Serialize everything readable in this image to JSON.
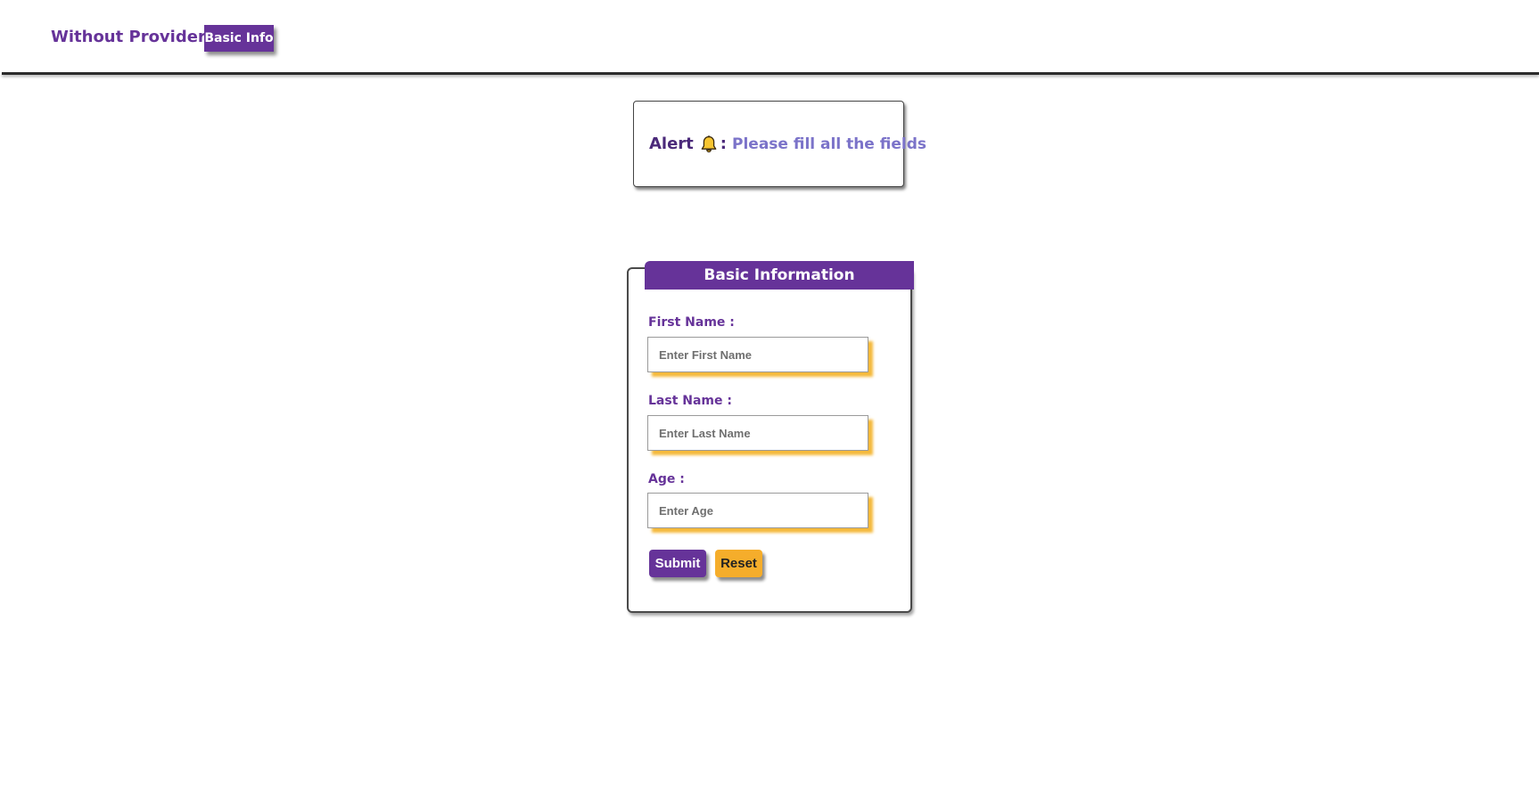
{
  "header": {
    "brand": "Without Providers",
    "nav_button_label": "Basic Info"
  },
  "alert": {
    "label": "Alert",
    "icon": "bell-icon",
    "separator": ":",
    "message": "Please fill all the fields"
  },
  "form": {
    "title": "Basic Information",
    "first_name": {
      "label": "First Name :",
      "placeholder": "Enter First Name",
      "value": ""
    },
    "last_name": {
      "label": "Last Name :",
      "placeholder": "Enter Last Name",
      "value": ""
    },
    "age": {
      "label": "Age :",
      "placeholder": "Enter Age",
      "value": ""
    },
    "submit_label": "Submit",
    "reset_label": "Reset"
  },
  "colors": {
    "primary": "#663399",
    "accent": "#f5ad2b",
    "alert_message": "#7b73c9"
  }
}
